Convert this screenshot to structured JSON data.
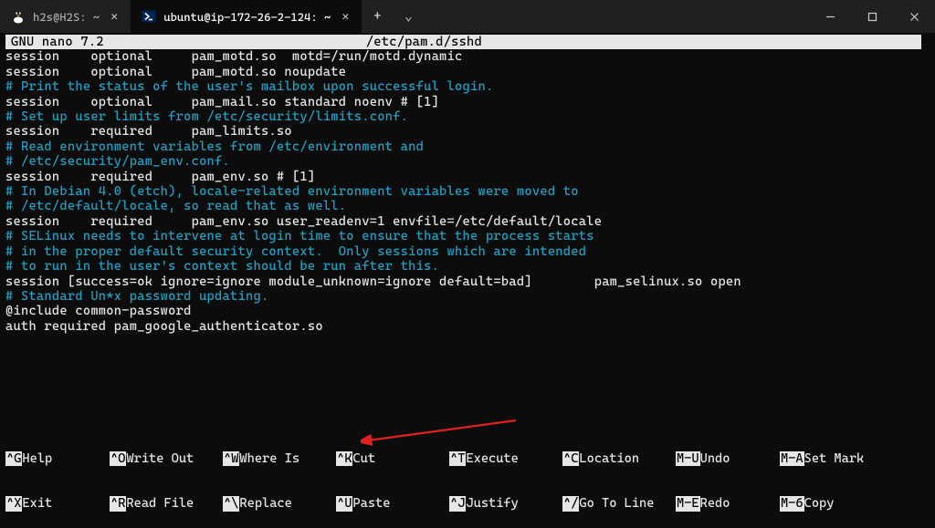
{
  "titlebar": {
    "tabs": [
      {
        "icon": "tux",
        "label": "h2s@H2S: ~"
      },
      {
        "icon": "ps",
        "label": "ubuntu@ip-172-26-2-124: ~"
      }
    ],
    "add": "+",
    "drop": "⌄"
  },
  "header": {
    "left": "GNU nano 7.2",
    "file": "/etc/pam.d/sshd"
  },
  "lines": {
    "l01a": "session    optional     pam_motd.so  motd=/run/motd.dynamic",
    "l01b": "session    optional     pam_motd.so noupdate",
    "c02": "# Print the status of the user's mailbox upon successful login.",
    "l02": "session    optional     pam_mail.so standard noenv # [1]",
    "c03": "# Set up user limits from /etc/security/limits.conf.",
    "l03": "session    required     pam_limits.so",
    "c04a": "# Read environment variables from /etc/environment and",
    "c04b": "# /etc/security/pam_env.conf.",
    "l04": "session    required     pam_env.so # [1]",
    "c05a": "# In Debian 4.0 (etch), locale-related environment variables were moved to",
    "c05b": "# /etc/default/locale, so read that as well.",
    "l05": "session    required     pam_env.so user_readenv=1 envfile=/etc/default/locale",
    "c06a": "# SELinux needs to intervene at login time to ensure that the process starts",
    "c06b": "# in the proper default security context.  Only sessions which are intended",
    "c06c": "# to run in the user's context should be run after this.",
    "l06": "session [success=ok ignore=ignore module_unknown=ignore default=bad]        pam_selinux.so open",
    "c07": "# Standard Un*x password updating.",
    "l07": "@include common-password",
    "l08": "auth required pam_google_authenticator.so"
  },
  "shortcuts": {
    "row1": [
      {
        "k": "^G",
        "t": "Help"
      },
      {
        "k": "^O",
        "t": "Write Out"
      },
      {
        "k": "^W",
        "t": "Where Is"
      },
      {
        "k": "^K",
        "t": "Cut"
      },
      {
        "k": "^T",
        "t": "Execute"
      },
      {
        "k": "^C",
        "t": "Location"
      },
      {
        "k": "M-U",
        "t": "Undo"
      },
      {
        "k": "M-A",
        "t": "Set Mark"
      }
    ],
    "row2": [
      {
        "k": "^X",
        "t": "Exit"
      },
      {
        "k": "^R",
        "t": "Read File"
      },
      {
        "k": "^\\",
        "t": "Replace"
      },
      {
        "k": "^U",
        "t": "Paste"
      },
      {
        "k": "^J",
        "t": "Justify"
      },
      {
        "k": "^/",
        "t": "Go To Line"
      },
      {
        "k": "M-E",
        "t": "Redo"
      },
      {
        "k": "M-6",
        "t": "Copy"
      }
    ]
  }
}
